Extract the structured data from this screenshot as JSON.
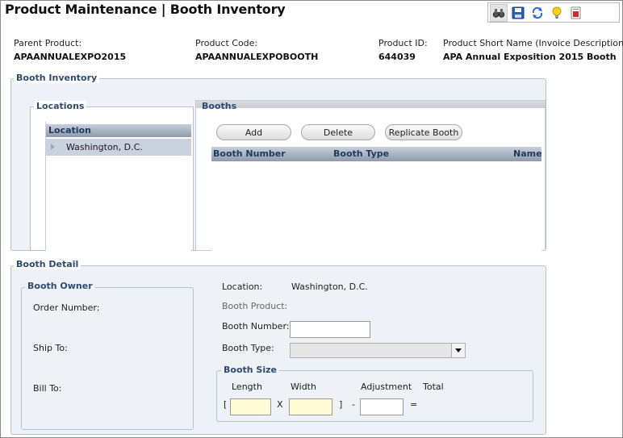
{
  "header": {
    "title": "Product Maintenance  |  Booth Inventory"
  },
  "toolbar": {
    "buttons": [
      {
        "name": "binoculars-icon"
      },
      {
        "name": "save-icon"
      },
      {
        "name": "refresh-icon"
      },
      {
        "name": "lightbulb-icon"
      },
      {
        "name": "report-icon"
      }
    ]
  },
  "info": {
    "parent_product_label": "Parent Product:",
    "parent_product_value": "APAANNUALEXPO2015",
    "product_code_label": "Product Code:",
    "product_code_value": "APAANNUALEXPOBOOTH",
    "product_id_label": "Product ID:",
    "product_id_value": "644039",
    "short_name_label": "Product Short Name (Invoice Description):",
    "short_name_value": "APA Annual Exposition 2015 Booth"
  },
  "booth_inventory": {
    "legend": "Booth Inventory",
    "locations": {
      "legend": "Locations",
      "column_header": "Location",
      "items": [
        "Washington, D.C."
      ]
    },
    "booths": {
      "legend": "Booths",
      "add_label": "Add",
      "delete_label": "Delete",
      "replicate_label": "Replicate Booth",
      "columns": [
        "Booth Number",
        "Booth Type",
        "Name"
      ]
    }
  },
  "booth_detail": {
    "legend": "Booth Detail",
    "owner": {
      "legend": "Booth Owner",
      "order_number_label": "Order Number:",
      "ship_to_label": "Ship To:",
      "bill_to_label": "Bill To:"
    },
    "location_label": "Location:",
    "location_value": "Washington, D.C.",
    "booth_product_label": "Booth Product:",
    "booth_number_label": "Booth Number:",
    "booth_number_value": "",
    "booth_type_label": "Booth Type:",
    "booth_type_value": "",
    "booth_size": {
      "legend": "Booth Size",
      "length_label": "Length",
      "width_label": "Width",
      "adjustment_label": "Adjustment",
      "total_label": "Total",
      "open_bracket": "[",
      "times": "X",
      "close_bracket": "]",
      "minus": "-",
      "equals": "=",
      "length_value": "",
      "width_value": "",
      "adjustment_value": ""
    }
  }
}
